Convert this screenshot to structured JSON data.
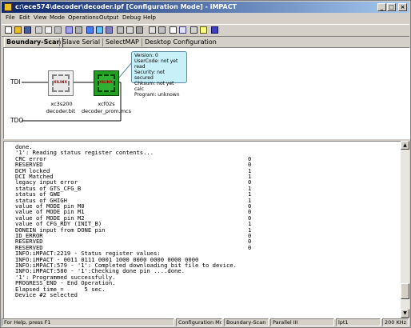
{
  "window": {
    "title": "c:\\ece574\\decoder\\decoder.ipf [Configuration Mode] - iMPACT"
  },
  "menu": [
    "File",
    "Edit",
    "View",
    "Mode",
    "Operations",
    "Output",
    "Debug",
    "Help"
  ],
  "tabs": [
    {
      "label": "Boundary-Scan",
      "active": true
    },
    {
      "label": "Slave Serial",
      "active": false
    },
    {
      "label": "SelectMAP",
      "active": false
    },
    {
      "label": "Desktop Configuration",
      "active": false
    }
  ],
  "chain": {
    "tdi_label": "TDI",
    "tdo_label": "TDO",
    "device1": {
      "name": "xc3s200",
      "file": "decoder.bit",
      "chip_text": "XILINX"
    },
    "device2": {
      "name": "xcf02s",
      "file": "decoder_prom.mcs",
      "chip_text": "XILINX",
      "selected": true
    },
    "info": [
      "Version: 0",
      "UserCode: not yet read",
      "Security: not secured",
      "Chksum: not yet calc",
      "Program: unknown"
    ]
  },
  "log": [
    {
      "text": "done.",
      "value": ""
    },
    {
      "text": "'1': Reading status register contents...",
      "value": ""
    },
    {
      "text": "CRC error",
      "value": "0"
    },
    {
      "text": "RESERVED",
      "value": "0"
    },
    {
      "text": "DCM locked",
      "value": "1"
    },
    {
      "text": "DCI Matched",
      "value": "1"
    },
    {
      "text": "legacy input error",
      "value": "0"
    },
    {
      "text": "status of GTS_CFG_B",
      "value": "1"
    },
    {
      "text": "status of GWE",
      "value": "1"
    },
    {
      "text": "status of GHIGH",
      "value": "1"
    },
    {
      "text": "value of MODE pin M0",
      "value": "0"
    },
    {
      "text": "value of MODE pin M1",
      "value": "0"
    },
    {
      "text": "value of MODE pin M2",
      "value": "0"
    },
    {
      "text": "value of CFG_RDY (INIT_B)",
      "value": "1"
    },
    {
      "text": "DONEIN input from DONE pin",
      "value": "1"
    },
    {
      "text": "ID_ERROR",
      "value": "0"
    },
    {
      "text": "RESERVED",
      "value": "0"
    },
    {
      "text": "RESERVED",
      "value": "0"
    },
    {
      "text": "INFO:iMPACT:2219 - Status register values:",
      "value": ""
    },
    {
      "text": "INFO:iMPACT - 0011 0111 0001 1000 0000 0000 0000 0000",
      "value": ""
    },
    {
      "text": "INFO:iMPACT:579 - '1': Completed downloading bit file to device.",
      "value": ""
    },
    {
      "text": "INFO:iMPACT:580 - '1':Checking done pin ....done.",
      "value": ""
    },
    {
      "text": "'1': Programmed successfully.",
      "value": ""
    },
    {
      "text": "PROGRESS_END - End Operation.",
      "value": ""
    },
    {
      "text": "Elapsed time =      5 sec.",
      "value": ""
    },
    {
      "text": "Device #2 selected",
      "value": ""
    }
  ],
  "status": {
    "help": "For Help, press F1",
    "mode": "Configuration Mode",
    "chain": "Boundary-Scan",
    "cable": "Parallel III",
    "port": "lpt1",
    "speed": "200 KHz"
  },
  "colors": {
    "titlebar_start": "#0a246a",
    "titlebar_end": "#a6caf0",
    "selected_chip": "#20a020",
    "callout_bg": "#c8f0f8"
  }
}
